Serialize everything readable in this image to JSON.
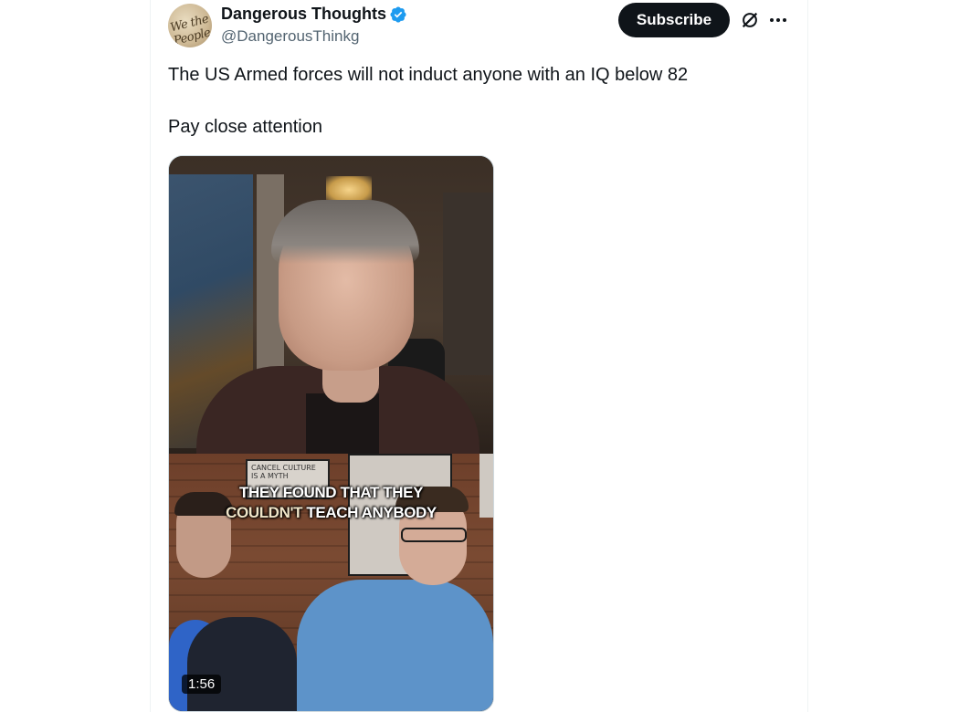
{
  "author": {
    "display_name": "Dangerous Thoughts",
    "handle": "@DangerousThinkg",
    "avatar_text": "We the People",
    "verified_icon": "verified-badge-icon",
    "verified_color": "#1d9bf0"
  },
  "actions": {
    "subscribe_label": "Subscribe",
    "grok_icon": "grok-icon",
    "more_icon": "more-horizontal-icon"
  },
  "post": {
    "line1": "The US Armed forces will not induct anyone with an IQ below 82",
    "line2": "Pay close attention"
  },
  "media": {
    "poster_text": "CANCEL CULTURE IS A MYTH",
    "caption_line1": "THEY FOUND THAT THEY",
    "caption_line2_a": "COULDN'T",
    "caption_line2_b": "TEACH ANYBODY",
    "duration": "1:56"
  },
  "colors": {
    "text_primary": "#0f1419",
    "text_secondary": "#536471",
    "button_bg": "#0f1419",
    "border": "#eff3f4"
  }
}
